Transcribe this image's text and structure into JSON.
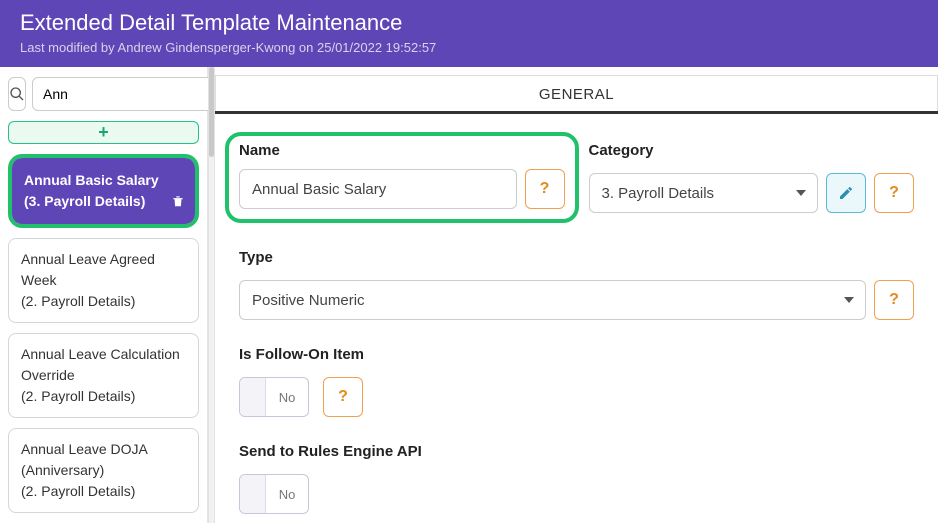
{
  "header": {
    "title": "Extended Detail Template Maintenance",
    "subtitle": "Last modified by Andrew Gindensperger-Kwong on 25/01/2022 19:52:57"
  },
  "sidebar": {
    "search_value": "Ann",
    "add_label": "+",
    "items": [
      {
        "title": "Annual Basic Salary",
        "sub": "(3. Payroll Details)",
        "selected": true
      },
      {
        "title": "Annual Leave Agreed Week",
        "sub": "(2. Payroll Details)",
        "selected": false
      },
      {
        "title": "Annual Leave Calculation Override",
        "sub": "(2. Payroll Details)",
        "selected": false
      },
      {
        "title": "Annual Leave DOJA (Anniversary)",
        "sub": "(2. Payroll Details)",
        "selected": false
      }
    ]
  },
  "tabs": {
    "general": "GENERAL"
  },
  "form": {
    "name_label": "Name",
    "name_value": "Annual Basic Salary",
    "category_label": "Category",
    "category_value": "3. Payroll Details",
    "type_label": "Type",
    "type_value": "Positive Numeric",
    "followon_label": "Is Follow-On Item",
    "followon_value": "No",
    "rules_label": "Send to Rules Engine API",
    "rules_value": "No",
    "help_label": "?"
  }
}
